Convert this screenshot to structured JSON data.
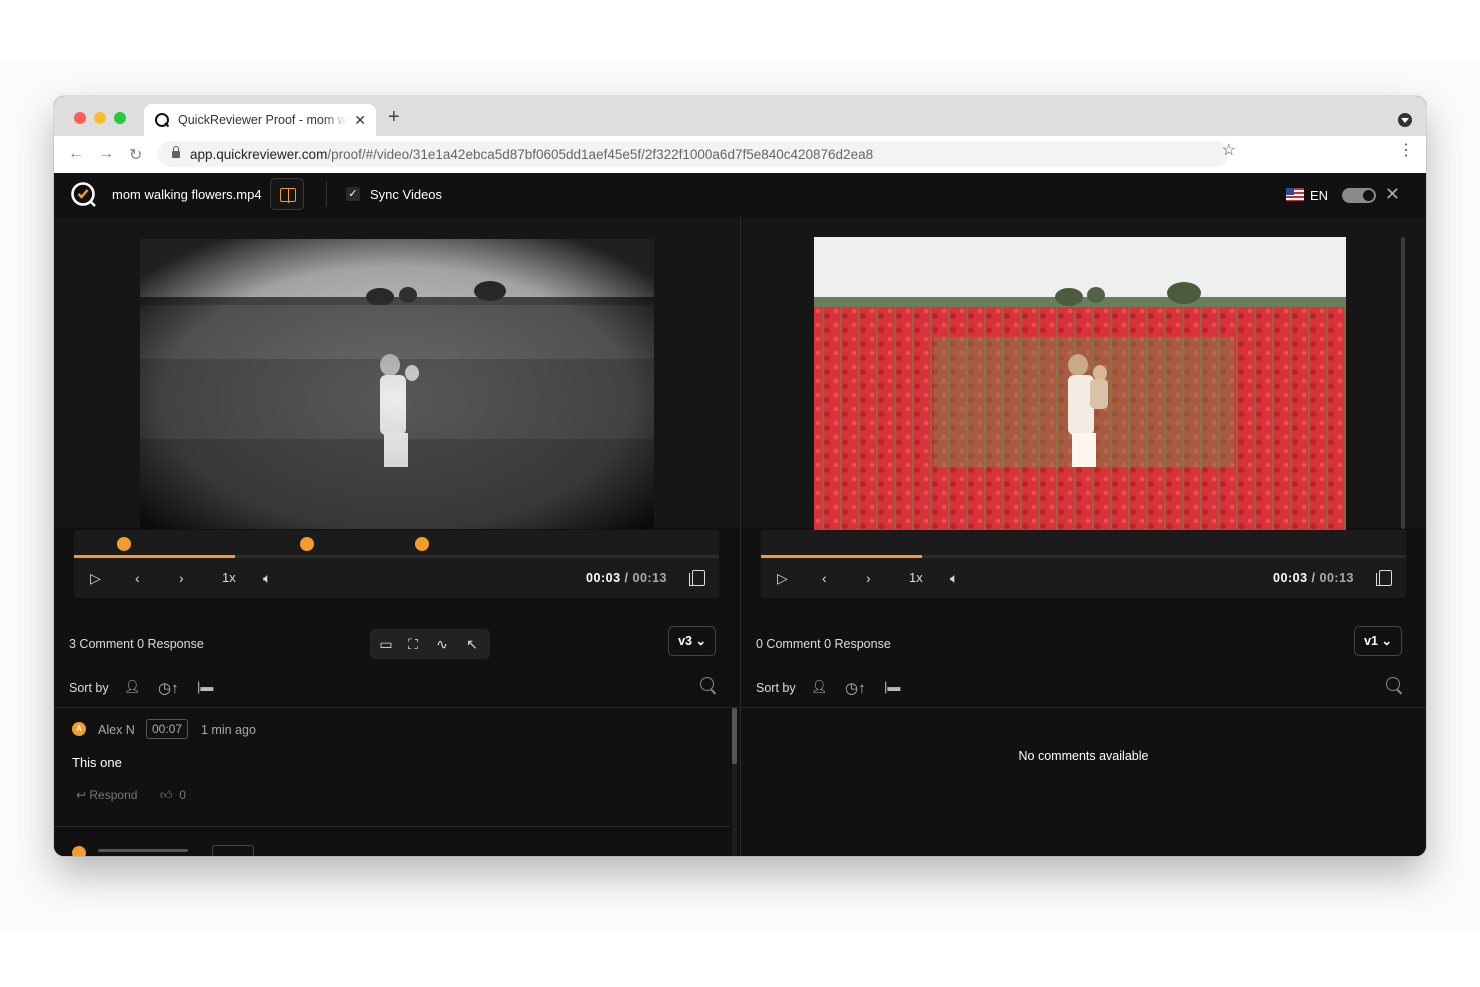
{
  "browser": {
    "tab_title": "QuickReviewer Proof - mom walking flowers.mp4",
    "tab_close": "✕",
    "new_tab": "+",
    "url_host": "app.quickreviewer.com",
    "url_path": "/proof/#/video/31e1a42ebca5d87bf0605dd1aef45e5f/2f322f1000a6d7f5e840c420876d2ea8"
  },
  "app": {
    "file_name": "mom walking flowers.mp4",
    "sync_label": "Sync Videos",
    "sync_checked": true,
    "language": "EN",
    "accent_color": "#f39c2a"
  },
  "left_player": {
    "current_time": "00:03",
    "total_time": "00:13",
    "progress_fraction": 0.25,
    "speed": "1x",
    "marker_positions": [
      "00:01",
      "00:04",
      "00:06"
    ]
  },
  "right_player": {
    "current_time": "00:03",
    "total_time": "00:13",
    "progress_fraction": 0.25,
    "speed": "1x"
  },
  "left_comments": {
    "summary": "3 Comment 0 Response",
    "version": "v3",
    "sort_label": "Sort by",
    "items": [
      {
        "avatar": "A",
        "author": "Alex N",
        "timestamp": "00:07",
        "ago": "1 min ago",
        "text": "This one",
        "respond": "Respond",
        "likes": "0"
      }
    ]
  },
  "right_comments": {
    "summary": "0 Comment 0 Response",
    "version": "v1",
    "sort_label": "Sort by",
    "empty": "No comments available"
  }
}
